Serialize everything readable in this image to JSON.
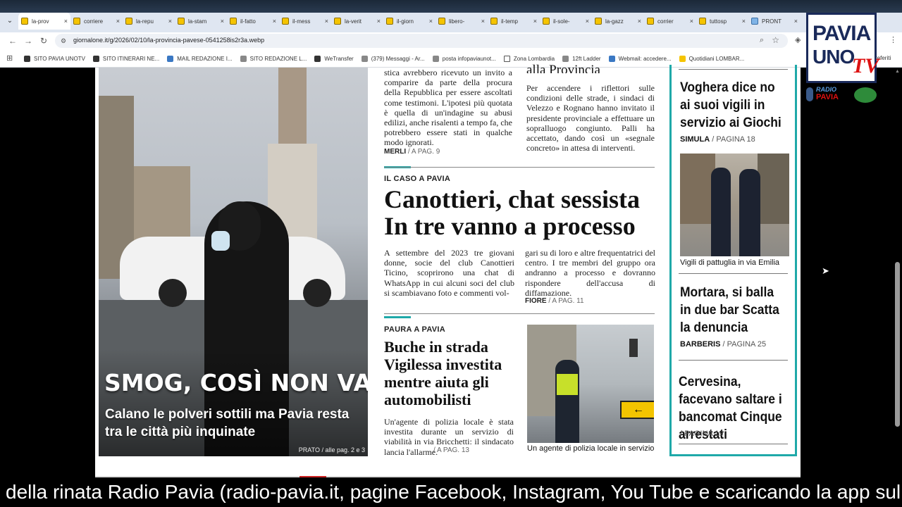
{
  "browser": {
    "tabs": [
      {
        "label": "la-prov",
        "active": true
      },
      {
        "label": "corriere"
      },
      {
        "label": "la-repu"
      },
      {
        "label": "la-stam"
      },
      {
        "label": "il-fatto"
      },
      {
        "label": "il-mess"
      },
      {
        "label": "la-verit"
      },
      {
        "label": "il-giorn"
      },
      {
        "label": "libero-"
      },
      {
        "label": "il-temp"
      },
      {
        "label": "il-sole-"
      },
      {
        "label": "la-gazz"
      },
      {
        "label": "corrier"
      },
      {
        "label": "tuttosp"
      },
      {
        "label": "PRONT"
      }
    ],
    "tab_close": "×",
    "url": "giornalone.it/g/2026/02/10/la-provincia-pavese-0541258is2r3a.webp",
    "bookmarks": [
      "SITO PAVIA UNOTV",
      "SITO ITINERARI NE...",
      "MAIL REDAZIONE I...",
      "SITO REDAZIONE L...",
      "WeTransfer",
      "(379) Messaggi - Ar...",
      "posta infopaviaunot...",
      "Zona Lombardia",
      "12ft Ladder",
      "Webmail: accedere...",
      "Quotidiani LOMBAR..."
    ],
    "extra_label": "referiti"
  },
  "logo": {
    "line1": "PAVIA",
    "line2": "UNO",
    "tv": "TV",
    "radio_top": "RADIO",
    "radio_bottom": "PAVIA"
  },
  "newspaper": {
    "photo": {
      "title": "SMOG, COSÌ NON VA",
      "subtitle": "Calano le polveri sottili ma Pavia resta tra le città più inquinate",
      "credit": "PRATO / alle pag. 2 e 3"
    },
    "top_left_article": {
      "text": "stica avrebbero ricevuto un invito a comparire da parte della procura della Repubblica per essere ascoltati come testimoni. L'ipotesi più quotata è quella di un'indagine su abusi edilizi, anche risalenti a tempo fa, che potrebbero essere stati in qualche modo ignorati.",
      "author": "MERLI",
      "page": "/ A PAG. 9"
    },
    "top_right_article": {
      "heading": "alla Provincia",
      "text": "Per accendere i riflettori sulle condizioni delle strade, i sindaci di Velezzo e Rognano hanno invitato il presidente provinciale a effettuare un sopralluogo congiunto. Palli ha accettato, dando così un «segnale concreto» in attesa di interventi."
    },
    "main_article": {
      "kicker": "IL CASO A PAVIA",
      "headline_1": "Canottieri, chat sessista",
      "headline_2": "In tre vanno a processo",
      "col1": "A settembre del 2023 tre giovani donne, socie del club Canottieri Ticino, scoprirono una chat di WhatsApp in cui alcuni soci del club si scambiavano foto e commenti vol-",
      "col2": "gari su di loro e altre frequentatrici del centro. I tre membri del gruppo ora andranno a processo e dovranno rispondere dell'accusa di diffamazione.",
      "author": "FIORE",
      "page": "/ A PAG. 11"
    },
    "second_article": {
      "kicker": "PAURA A PAVIA",
      "headline": "Buche in strada Vigilessa investita mentre aiuta gli automobilisti",
      "text": "Un'agente di polizia locale è stata investita durante un servizio di viabilità in via Bricchetti: il sindacato lancia l'allarme.",
      "page": "/ A PAG. 13",
      "photo_caption": "Un agente di polizia locale in servizio"
    },
    "sidebar": {
      "item1": {
        "headline": "Voghera dice no ai suoi vigili in servizio ai Giochi",
        "author": "SIMULA",
        "page": "/ PAGINA 18"
      },
      "photo_caption": "Vigili di pattuglia in via Emilia",
      "item2": {
        "headline": "Mortara, si balla in due bar Scatta la denuncia",
        "author": "BARBERIS",
        "page": "/ PAGINA 25"
      },
      "item3": {
        "headline": "Cervesina, facevano saltare i bancomat Cinque arrestati",
        "page": "/ PAGINA 19"
      }
    }
  },
  "ticker": {
    "text": "della rinata Radio Pavia (radio-pavia.it, pagine Facebook, Instagram, You Tube e scaricando la app sul v"
  },
  "colors": {
    "accent_teal": "#1fa9a9",
    "logo_navy": "#1a2a5a",
    "logo_red": "#dd1111"
  }
}
